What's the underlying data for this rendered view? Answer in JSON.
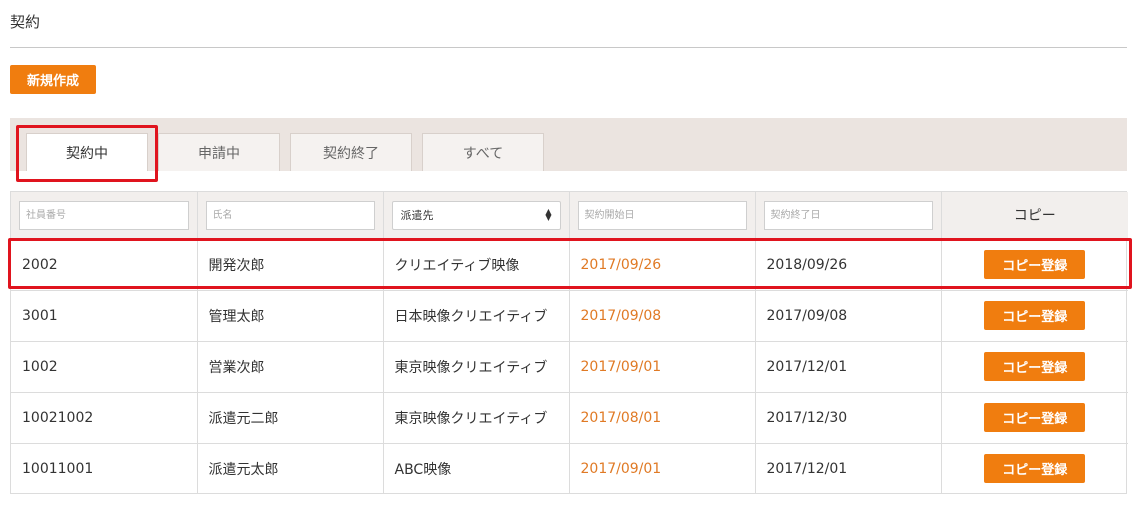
{
  "page": {
    "title": "契約"
  },
  "toolbar": {
    "new_label": "新規作成"
  },
  "tabs": [
    {
      "label": "契約中",
      "active": true
    },
    {
      "label": "申請中",
      "active": false
    },
    {
      "label": "契約終了",
      "active": false
    },
    {
      "label": "すべて",
      "active": false
    }
  ],
  "filters": {
    "employee_no_placeholder": "社員番号",
    "name_placeholder": "氏名",
    "dispatch_select_value": "派遣先",
    "start_date_placeholder": "契約開始日",
    "end_date_placeholder": "契約終了日",
    "copy_header": "コピー"
  },
  "rows": [
    {
      "employee_no": "2002",
      "name": "開発次郎",
      "dispatch": "クリエイティブ映像",
      "start": "2017/09/26",
      "end": "2018/09/26",
      "copy_label": "コピー登録"
    },
    {
      "employee_no": "3001",
      "name": "管理太郎",
      "dispatch": "日本映像クリエイティブ",
      "start": "2017/09/08",
      "end": "2017/09/08",
      "copy_label": "コピー登録"
    },
    {
      "employee_no": "1002",
      "name": "営業次郎",
      "dispatch": "東京映像クリエイティブ",
      "start": "2017/09/01",
      "end": "2017/12/01",
      "copy_label": "コピー登録"
    },
    {
      "employee_no": "10021002",
      "name": "派遣元二郎",
      "dispatch": "東京映像クリエイティブ",
      "start": "2017/08/01",
      "end": "2017/12/30",
      "copy_label": "コピー登録"
    },
    {
      "employee_no": "10011001",
      "name": "派遣元太郎",
      "dispatch": "ABC映像",
      "start": "2017/09/01",
      "end": "2017/12/01",
      "copy_label": "コピー登録"
    }
  ],
  "colors": {
    "accent": "#f07d0f",
    "start_date": "#e07a25",
    "highlight": "#e0141e",
    "tab_bar": "#ebe4e0"
  },
  "icons": {
    "select_arrows": "up-down-arrows-icon"
  }
}
